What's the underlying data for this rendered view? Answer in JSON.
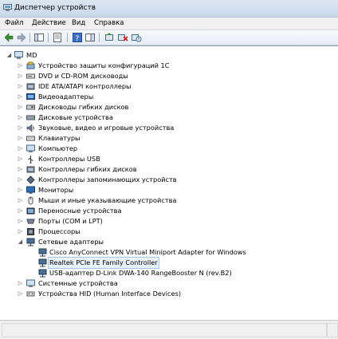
{
  "window": {
    "title": "Диспетчер устройств"
  },
  "menu": [
    "Файл",
    "Действие",
    "Вид",
    "Справка"
  ],
  "tree": {
    "root": "MD",
    "categories": [
      "Устройство защиты конфигураций 1С",
      "DVD и CD-ROM дисководы",
      "IDE ATA/ATAPI контроллеры",
      "Видеоадаптеры",
      "Дисководы гибких дисков",
      "Дисковые устройства",
      "Звуковые, видео и игровые устройства",
      "Клавиатуры",
      "Компьютер",
      "Контроллеры USB",
      "Контроллеры гибких дисков",
      "Контроллеры запоминающих устройств",
      "Мониторы",
      "Мыши и иные указывающие устройства",
      "Переносные устройства",
      "Порты (COM и LPT)",
      "Процессоры",
      "Сетевые адаптеры"
    ],
    "network_children": [
      "Cisco AnyConnect VPN Virtual Miniport Adapter for Windows",
      "Realtek PCIe FE Family Controller",
      "USB-адаптер D-Link DWA-140 RangeBooster N (rev.B2)"
    ],
    "tail_categories": [
      "Системные устройства",
      "Устройства HID (Human Interface Devices)"
    ]
  }
}
